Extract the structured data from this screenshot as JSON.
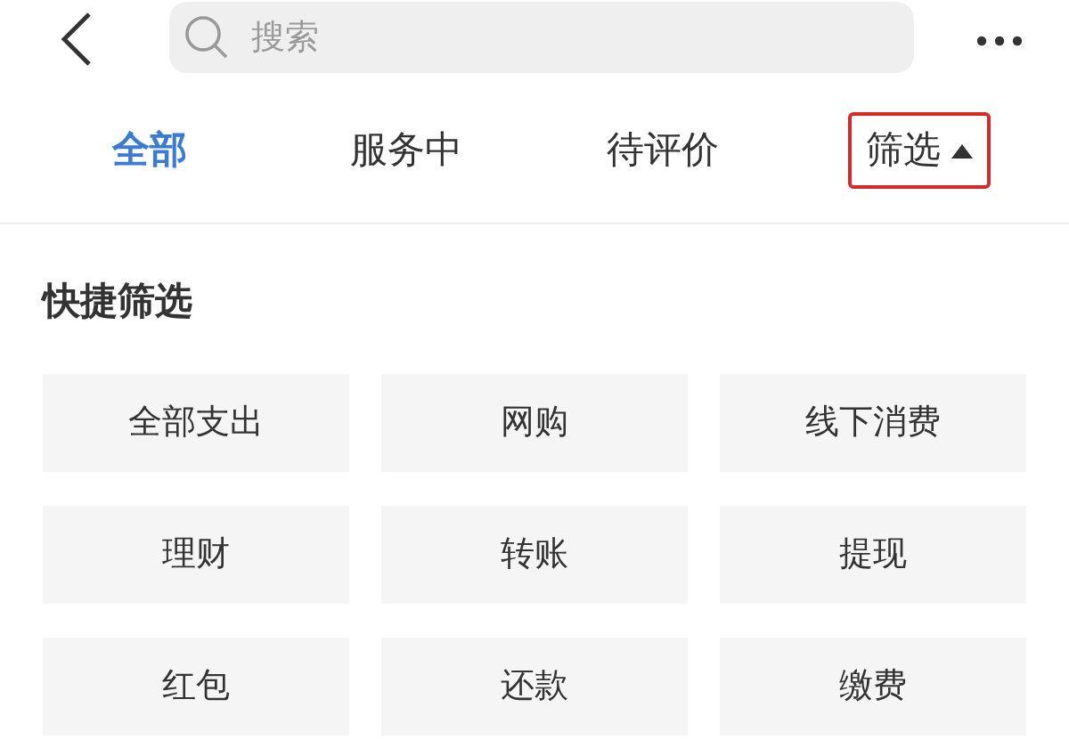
{
  "search": {
    "placeholder": "搜索"
  },
  "tabs": [
    {
      "label": "全部",
      "selected": true,
      "kind": "plain"
    },
    {
      "label": "服务中",
      "selected": false,
      "kind": "plain"
    },
    {
      "label": "待评价",
      "selected": false,
      "kind": "plain"
    },
    {
      "label": "筛选",
      "selected": false,
      "kind": "dropdown",
      "expanded": true,
      "highlighted": true
    }
  ],
  "quick_filter": {
    "title": "快捷筛选",
    "options": [
      "全部支出",
      "网购",
      "线下消费",
      "理财",
      "转账",
      "提现",
      "红包",
      "还款",
      "缴费"
    ]
  }
}
